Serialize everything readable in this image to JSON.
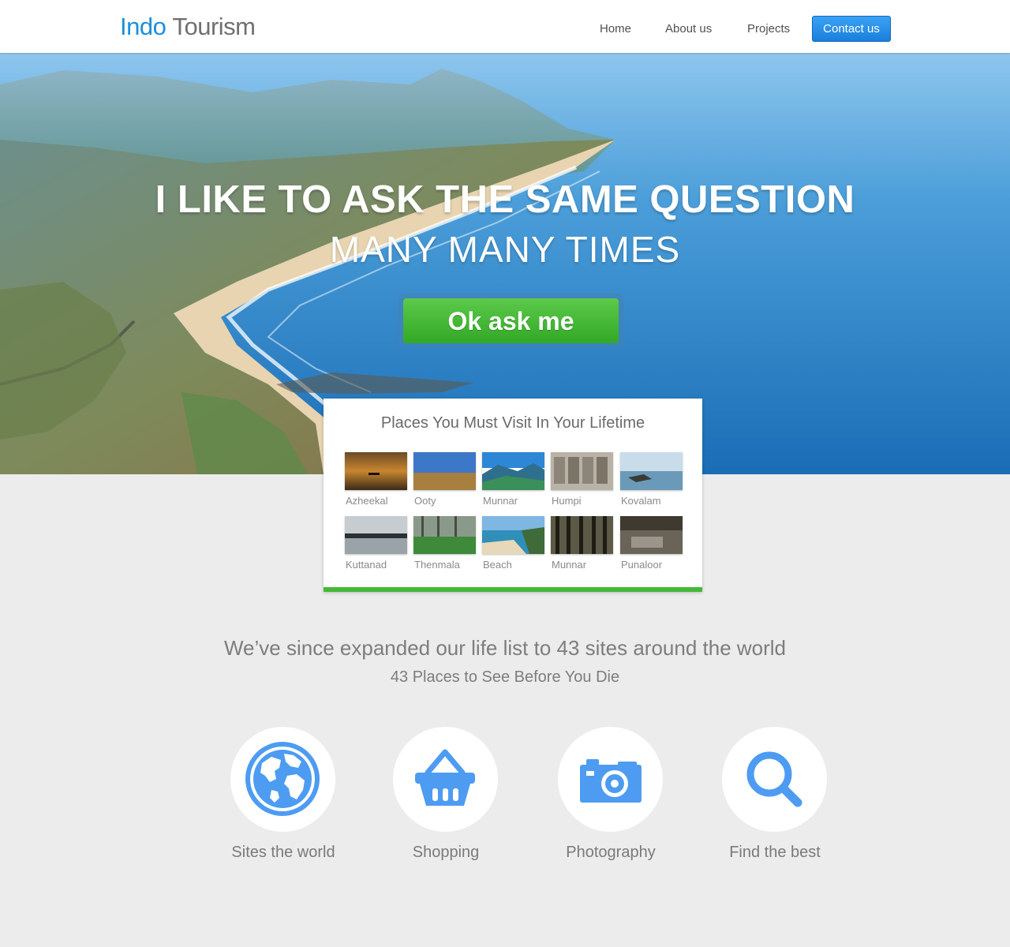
{
  "header": {
    "logo_primary": "Indo",
    "logo_secondary": "Tourism",
    "nav": [
      "Home",
      "About us",
      "Projects"
    ],
    "cta": "Contact us"
  },
  "hero": {
    "title": "I LIKE TO ASK THE SAME QUESTION",
    "subtitle": "MANY MANY TIMES",
    "button": "Ok ask me"
  },
  "places": {
    "title": "Places You Must Visit In Your Lifetime",
    "items": [
      "Azheekal",
      "Ooty",
      "Munnar",
      "Humpi",
      "Kovalam",
      "Kuttanad",
      "Thenmala",
      "Beach",
      "Munnar",
      "Punaloor"
    ]
  },
  "intro": {
    "headline": "We’ve since expanded our life list to 43 sites around the world",
    "subline": "43 Places to See Before You Die"
  },
  "features": [
    {
      "label": "Sites the world",
      "icon": "globe-icon"
    },
    {
      "label": "Shopping",
      "icon": "basket-icon"
    },
    {
      "label": "Photography",
      "icon": "camera-icon"
    },
    {
      "label": "Find the best",
      "icon": "search-icon"
    }
  ],
  "colors": {
    "brand_blue": "#1b8fdc",
    "cta_green": "#43b937",
    "icon_blue": "#4d9cf2",
    "page_background": "#ececec"
  }
}
